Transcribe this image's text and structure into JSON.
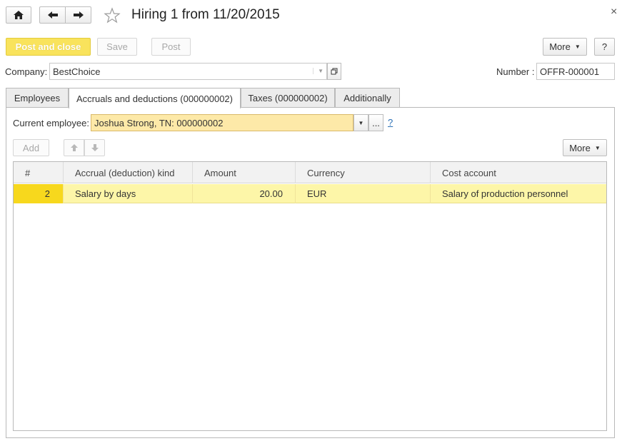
{
  "window": {
    "title": "Hiring 1 from 11/20/2015",
    "close_glyph": "×"
  },
  "nav": {
    "home_icon": "home-icon",
    "back_icon": "arrow-left-icon",
    "forward_icon": "arrow-right-icon",
    "favorite_icon": "star-icon"
  },
  "toolbar": {
    "post_close_label": "Post and close",
    "save_label": "Save",
    "post_label": "Post",
    "more_label": "More",
    "help_label": "?"
  },
  "company": {
    "label": "Company:",
    "value": "BestChoice"
  },
  "number": {
    "label": "Number :",
    "value": "OFFR-000001"
  },
  "tabs": [
    {
      "label": "Employees"
    },
    {
      "label": "Accruals and deductions (000000002)"
    },
    {
      "label": "Taxes (000000002)"
    },
    {
      "label": "Additionally"
    }
  ],
  "current_employee": {
    "label": "Current employee:",
    "value": "Joshua Strong, TN: 000000002",
    "ellipsis": "...",
    "help": "?"
  },
  "table_toolbar": {
    "add_label": "Add",
    "more_label": "More"
  },
  "table": {
    "columns": [
      "#",
      "Accrual (deduction) kind",
      "Amount",
      "Currency",
      "Cost account"
    ],
    "rows": [
      {
        "num": "2",
        "kind": "Salary by days",
        "amount": "20.00",
        "currency": "EUR",
        "account": "Salary of production personnel"
      }
    ]
  },
  "colors": {
    "accent_yellow": "#f9e35c",
    "selected_row": "#fdf6a8",
    "selected_cell": "#f7d81d",
    "link_blue": "#2a6fb5"
  }
}
